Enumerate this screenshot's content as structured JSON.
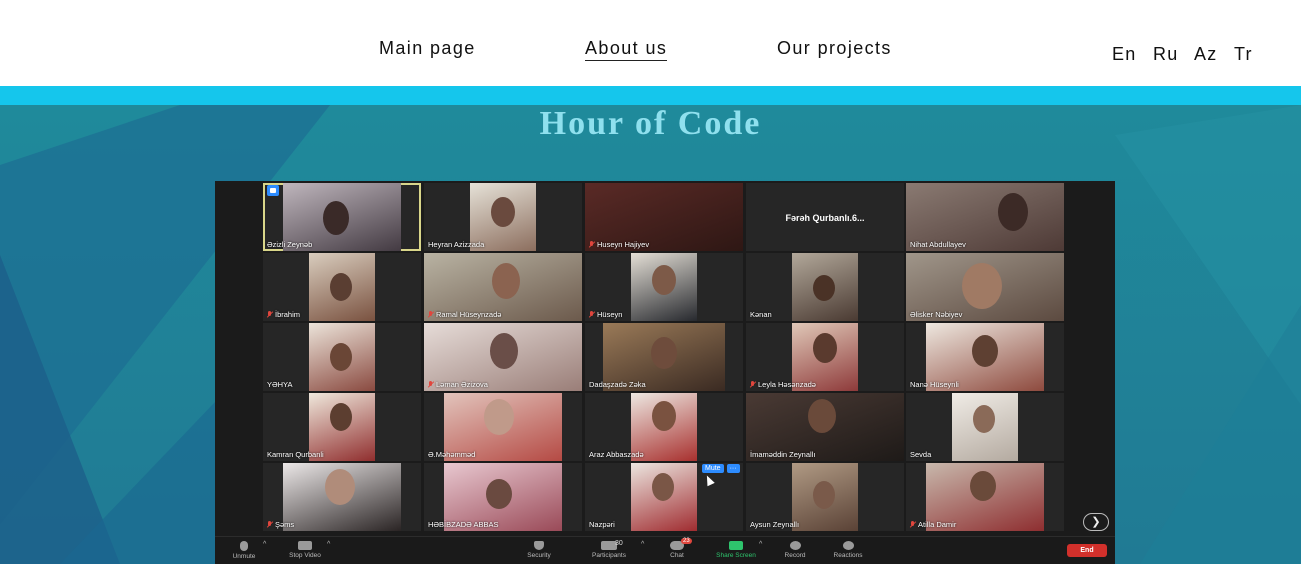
{
  "nav": {
    "links": [
      "Main page",
      "About us",
      "Our projects"
    ],
    "active": "About us",
    "languages": [
      "En",
      "Ru",
      "Az",
      "Tr"
    ]
  },
  "hero": {
    "title": "Hour of Code"
  },
  "zoom": {
    "participants": [
      "Əzizli Zeynəb",
      "Heyran Azizzada",
      "Huseyn Hajiyev",
      "Fərəh Qurbanlı.6...",
      "Nihat Abdullayev",
      "İbrahim",
      "Ramal Hüseynzadə",
      "Hüseyn",
      "Kənan",
      "Əlisker Nəbiyev",
      "YƏHYA",
      "Ləman Əzizova",
      "Dadaşzadə Zəka",
      "Leyla Həsənzadə",
      "Nanə Hüseynli",
      "Kamran Qurbanli",
      "Ə.Məhəmməd",
      "Araz Abbaszadə",
      "İmaməddin Zeynallı",
      "Sevda",
      "Şəms",
      "HƏBİBZADƏ ABBAS",
      "Nazpəri",
      "Aysun Zeynallı",
      "Atilla Damir"
    ],
    "popup": {
      "mute": "Mute",
      "more": "···"
    },
    "next_icon": "chevron-right-icon",
    "toolbar": {
      "unmute": "Unmute",
      "stop_video": "Stop Video",
      "security": "Security",
      "participants": "Participants",
      "participants_count": "30",
      "chat": "Chat",
      "chat_badge": "23",
      "share_screen": "Share Screen",
      "record": "Record",
      "reactions": "Reactions",
      "end": "End"
    }
  },
  "colors": {
    "accent_strip": "#15c6ec",
    "hero_bg": "#1f8a9b",
    "title": "#8fe0ee",
    "zoom_blue": "#2d8cff",
    "end_red": "#d2302b",
    "share_green": "#2ec46d"
  }
}
